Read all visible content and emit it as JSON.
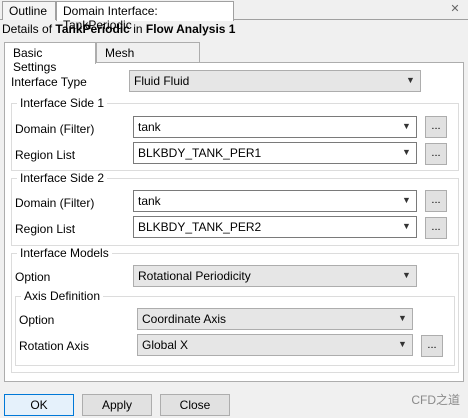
{
  "tabs": {
    "outline": "Outline",
    "domain_interface": "Domain Interface: TankPeriodic"
  },
  "details": {
    "prefix": "Details of",
    "name": "TankPeriodic",
    "mid": "in",
    "analysis": "Flow Analysis 1"
  },
  "subtabs": {
    "basic": "Basic Settings",
    "mesh": "Mesh Connection"
  },
  "interface_type": {
    "label": "Interface Type",
    "value": "Fluid Fluid"
  },
  "side1": {
    "title": "Interface Side 1",
    "domain_label": "Domain (Filter)",
    "domain_value": "tank",
    "region_label": "Region List",
    "region_value": "BLKBDY_TANK_PER1"
  },
  "side2": {
    "title": "Interface Side 2",
    "domain_label": "Domain (Filter)",
    "domain_value": "tank",
    "region_label": "Region List",
    "region_value": "BLKBDY_TANK_PER2"
  },
  "models": {
    "title": "Interface Models",
    "option_label": "Option",
    "option_value": "Rotational Periodicity"
  },
  "axis": {
    "title": "Axis Definition",
    "option_label": "Option",
    "option_value": "Coordinate Axis",
    "rot_label": "Rotation Axis",
    "rot_value": "Global X"
  },
  "buttons": {
    "ok": "OK",
    "apply": "Apply",
    "close": "Close"
  },
  "ellipsis": "...",
  "watermark": "CFD之道",
  "close_glyph": "✕",
  "arrow_glyph": "▼"
}
